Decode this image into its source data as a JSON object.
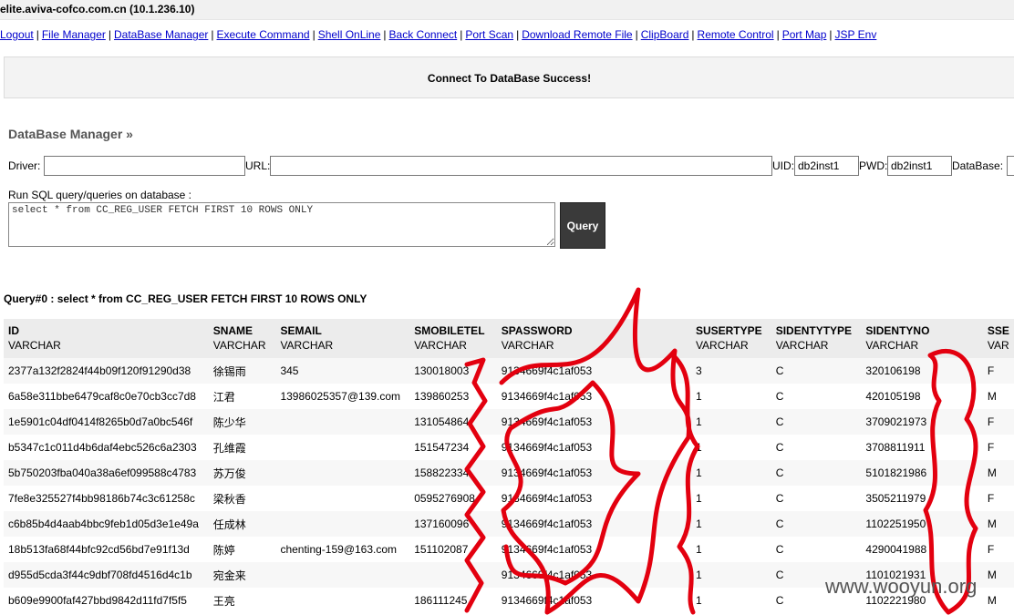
{
  "host_title": "elite.aviva-cofco.com.cn (10.1.236.10)",
  "nav": [
    "Logout",
    "File Manager",
    "DataBase Manager",
    "Execute Command",
    "Shell OnLine",
    "Back Connect",
    "Port Scan",
    "Download Remote File",
    "ClipBoard",
    "Remote Control",
    "Port Map",
    "JSP Env"
  ],
  "status_message": "Connect To DataBase Success!",
  "section_title": "DataBase Manager »",
  "connection": {
    "driver_label": "Driver:",
    "driver_value": "",
    "url_label": "URL:",
    "url_value": "",
    "uid_label": "UID:",
    "uid_value": "db2inst1",
    "pwd_label": "PWD:",
    "pwd_value": "db2inst1",
    "database_label": "DataBase:"
  },
  "sql_label": "Run SQL query/queries on database :",
  "sql_text": "select * from CC_REG_USER FETCH FIRST 10 ROWS ONLY",
  "query_button": "Query",
  "query_title": "Query#0 : select * from CC_REG_USER FETCH FIRST 10 ROWS ONLY",
  "columns": [
    {
      "name": "ID",
      "type": "VARCHAR"
    },
    {
      "name": "SNAME",
      "type": "VARCHAR"
    },
    {
      "name": "SEMAIL",
      "type": "VARCHAR"
    },
    {
      "name": "SMOBILETEL",
      "type": "VARCHAR"
    },
    {
      "name": "SPASSWORD",
      "type": "VARCHAR"
    },
    {
      "name": "SUSERTYPE",
      "type": "VARCHAR"
    },
    {
      "name": "SIDENTYTYPE",
      "type": "VARCHAR"
    },
    {
      "name": "SIDENTYNO",
      "type": "VARCHAR"
    },
    {
      "name": "SSE",
      "type": "VAR"
    }
  ],
  "rows": [
    [
      "2377a132f2824f44b09f120f91290d38",
      "徐锡雨",
      "345",
      "130018003",
      "9134669f4c1af053",
      "3",
      "C",
      "320106198",
      "F"
    ],
    [
      "6a58e311bbe6479caf8c0e70cb3cc7d8",
      "江君",
      "13986025357@139.com",
      "139860253",
      "9134669f4c1af053",
      "1",
      "C",
      "420105198",
      "M"
    ],
    [
      "1e5901c04df0414f8265b0d7a0bc546f",
      "陈少华",
      "",
      "131054864",
      "9134669f4c1af053",
      "1",
      "C",
      "3709021973",
      "F"
    ],
    [
      "b5347c1c011d4b6daf4ebc526c6a2303",
      "孔维霞",
      "",
      "151547234",
      "9134669f4c1af053",
      "1",
      "C",
      "3708811911",
      "F"
    ],
    [
      "5b750203fba040a38a6ef099588c4783",
      "苏万俊",
      "",
      "158822334",
      "9134669f4c1af053",
      "1",
      "C",
      "5101821986",
      "M"
    ],
    [
      "7fe8e325527f4bb98186b74c3c61258c",
      "梁秋香",
      "",
      "0595276908",
      "9134669f4c1af053",
      "1",
      "C",
      "3505211979",
      "F"
    ],
    [
      "c6b85b4d4aab4bbc9feb1d05d3e1e49a",
      "任成林",
      "",
      "137160096",
      "9134669f4c1af053",
      "1",
      "C",
      "1102251950",
      "M"
    ],
    [
      "18b513fa68f44bfc92cd56bd7e91f13d",
      "陈婷",
      "chenting-159@163.com",
      "151102087",
      "9134669f4c1af053",
      "1",
      "C",
      "4290041988",
      "F"
    ],
    [
      "d955d5cda3f44c9dbf708fd4516d4c1b",
      "宛金来",
      "",
      "",
      "9134669f4c1af053",
      "1",
      "C",
      "1101021931",
      "M"
    ],
    [
      "b609e9900faf427bbd9842d11fd7f5f5",
      "王亮",
      "",
      "186111245",
      "9134669f4c1af053",
      "1",
      "C",
      "1102221980",
      "M"
    ]
  ],
  "watermark": "www.wooyun.org",
  "colors": {
    "link": "#0000cc",
    "scribble": "#e3000f",
    "button_bg": "#3a3a3a"
  }
}
